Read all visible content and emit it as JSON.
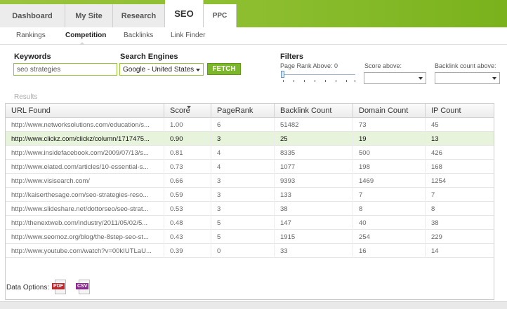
{
  "nav": {
    "tabs": [
      "Dashboard",
      "My Site",
      "Research",
      "SEO",
      "PPC"
    ],
    "active_tab": "SEO"
  },
  "subnav": {
    "items": [
      "Rankings",
      "Competition",
      "Backlinks",
      "Link Finder"
    ],
    "active": "Competition"
  },
  "form": {
    "keywords_label": "Keywords",
    "keywords_value": "seo strategies",
    "engines_label": "Search Engines",
    "engine_value": "Google - United States",
    "fetch_label": "FETCH"
  },
  "filters": {
    "title": "Filters",
    "page_rank_label": "Page Rank Above: 0",
    "page_rank_value": 0,
    "score_label": "Score above:",
    "backlink_label": "Backlink count above:"
  },
  "results": {
    "title": "Results",
    "columns": [
      "URL Found",
      "Score",
      "PageRank",
      "Backlink Count",
      "Domain Count",
      "IP Count"
    ],
    "rows": [
      [
        "http://www.networksolutions.com/education/s...",
        "1.00",
        "6",
        "51482",
        "73",
        "45"
      ],
      [
        "http://www.clickz.com/clickz/column/1717475...",
        "0.90",
        "3",
        "25",
        "19",
        "13"
      ],
      [
        "http://www.insidefacebook.com/2009/07/13/s...",
        "0.81",
        "4",
        "8335",
        "500",
        "426"
      ],
      [
        "http://www.elated.com/articles/10-essential-s...",
        "0.73",
        "4",
        "1077",
        "198",
        "168"
      ],
      [
        "http://www.visisearch.com/",
        "0.66",
        "3",
        "9393",
        "1469",
        "1254"
      ],
      [
        "http://kaiserthesage.com/seo-strategies-reso...",
        "0.59",
        "3",
        "133",
        "7",
        "7"
      ],
      [
        "http://www.slideshare.net/dottorseo/seo-strat...",
        "0.53",
        "3",
        "38",
        "8",
        "8"
      ],
      [
        "http://thenextweb.com/industry/2011/05/02/5...",
        "0.48",
        "5",
        "147",
        "40",
        "38"
      ],
      [
        "http://www.seomoz.org/blog/the-8step-seo-st...",
        "0.43",
        "5",
        "1915",
        "254",
        "229"
      ],
      [
        "http://www.youtube.com/watch?v=00kIUTLaU...",
        "0.39",
        "0",
        "33",
        "16",
        "14"
      ]
    ],
    "selected_row": 1
  },
  "data_options": {
    "label": "Data Options:",
    "pdf_label": "PDF",
    "csv_label": "CSV"
  },
  "colors": {
    "brand_green": "#8bbd2e",
    "selected_row": "#e8f3dc",
    "pdf_red": "#c0282d",
    "csv_purple": "#8a2a8e"
  }
}
